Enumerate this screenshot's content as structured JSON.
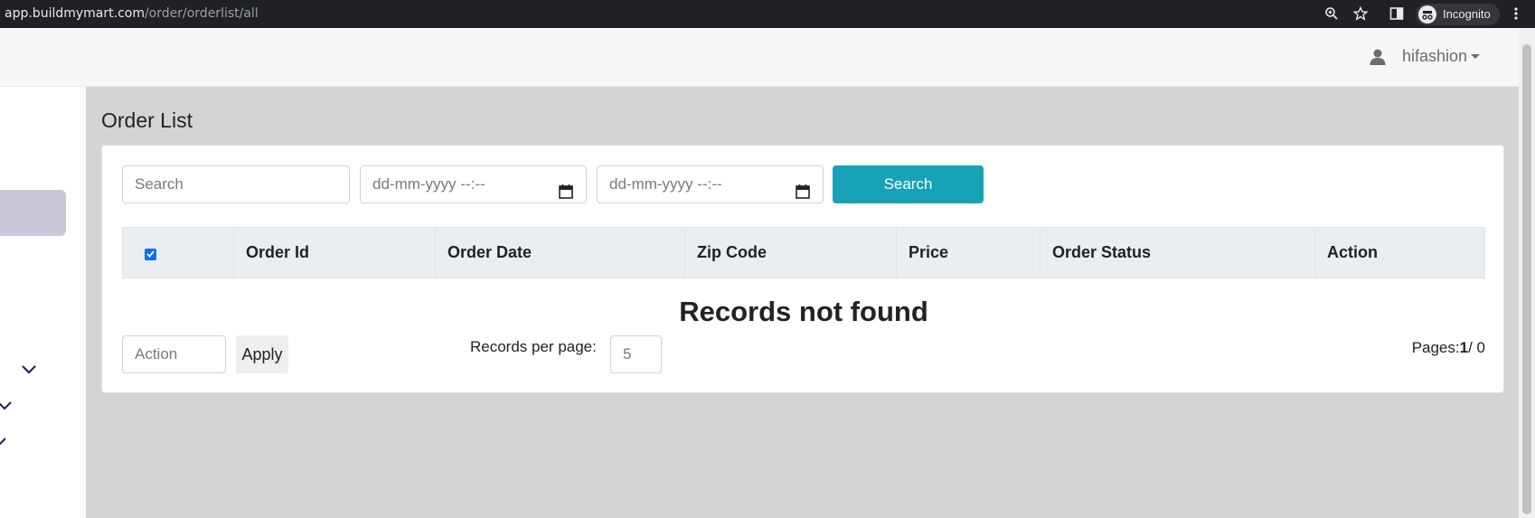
{
  "browser": {
    "url_host": "app.buildmymart.com",
    "url_path": "/order/orderlist/all",
    "mode_label": "Incognito"
  },
  "header": {
    "username": "hifashion"
  },
  "page": {
    "title": "Order List"
  },
  "filters": {
    "search_placeholder": "Search",
    "date_from_placeholder": "dd-mm-yyyy --:--",
    "date_to_placeholder": "dd-mm-yyyy --:--",
    "search_button": "Search"
  },
  "table": {
    "select_all_checked": true,
    "columns": [
      "Order Id",
      "Order Date",
      "Zip Code",
      "Price",
      "Order Status",
      "Action"
    ],
    "empty_message": "Records not found"
  },
  "footer": {
    "action_placeholder": "Action",
    "apply_button": "Apply",
    "records_per_page_label": "Records per page:",
    "records_per_page_value": "5",
    "pages_label": "Pages:",
    "current_page": "1",
    "total_pages": "/ 0"
  },
  "colors": {
    "accent": "#17a2b8",
    "checkbox": "#0b6efd",
    "content_bg": "#d4d4d4",
    "sidebar_active": "#cbc8d9"
  }
}
